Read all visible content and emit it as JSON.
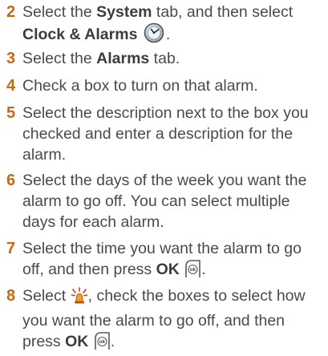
{
  "steps": [
    {
      "number": "2",
      "t1": "Select the ",
      "b1": "System",
      "t2": " tab, and then select",
      "b2": "Clock & Alarms",
      "t3": "."
    },
    {
      "number": "3",
      "t1": "Select the ",
      "b1": "Alarms",
      "t2": " tab."
    },
    {
      "number": "4",
      "text": "Check a box to turn on that alarm."
    },
    {
      "number": "5",
      "text": "Select the description next to the box you checked and enter a description for the alarm."
    },
    {
      "number": "6",
      "text": "Select the days of the week you want the alarm to go off. You can select multiple days for each alarm."
    },
    {
      "number": "7",
      "t1": "Select the time you want the alarm to go off, and then press ",
      "b1": "OK",
      "t2": "."
    },
    {
      "number": "8",
      "t1": "Select ",
      "t2": ", check the boxes to select how you want the alarm to go off, and then press ",
      "b1": "OK",
      "t3": "."
    }
  ],
  "icons": {
    "clock": "clock-alarms-icon",
    "ok": "ok-button-icon",
    "alarm_sound": "alarm-sound-icon"
  },
  "colors": {
    "step_number": "#c56a12",
    "body_text": "#4a4a4a",
    "bold_text": "#3c3c3c"
  }
}
